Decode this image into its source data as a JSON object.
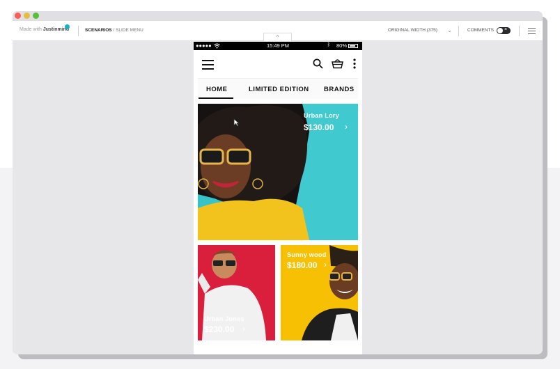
{
  "window": {
    "brand_prefix": "Made with",
    "brand_name": "Justinmind",
    "breadcrumb_section": "SCENARIOS",
    "breadcrumb_separator": " / ",
    "breadcrumb_page": "SLIDE MENU",
    "width_select": "ORIGINAL WIDTH (375)",
    "comments_label": "COMMENTS",
    "comments_toggle_on": false,
    "collapse_glyph": "^"
  },
  "phone": {
    "status": {
      "signal": "●●●●● ",
      "wifi": "wifi-icon",
      "time": "15:49 PM",
      "bluetooth": "bluetooth-icon",
      "battery": "80%"
    },
    "appbar": {
      "menu": "hamburger-icon",
      "search": "search-icon",
      "basket": "basket-icon",
      "more": "more-vertical-icon"
    },
    "tabs": [
      {
        "label": "HOME",
        "active": true
      },
      {
        "label": "LIMITED EDITION",
        "active": false
      },
      {
        "label": "BRANDS",
        "active": false
      }
    ],
    "hero": {
      "name": "Urban Lory",
      "price": "$130.00"
    },
    "cards": [
      {
        "name": "Urban Jones",
        "price": "$230.00",
        "bg": "#d91f3b"
      },
      {
        "name": "Sunny wood",
        "price": "$180.00",
        "bg": "#f7c002"
      }
    ]
  },
  "colors": {
    "brand_dot": "#16b1c8",
    "hero_bg": "#38c3c9",
    "card_red": "#d91f3b",
    "card_yellow": "#f7c002"
  }
}
